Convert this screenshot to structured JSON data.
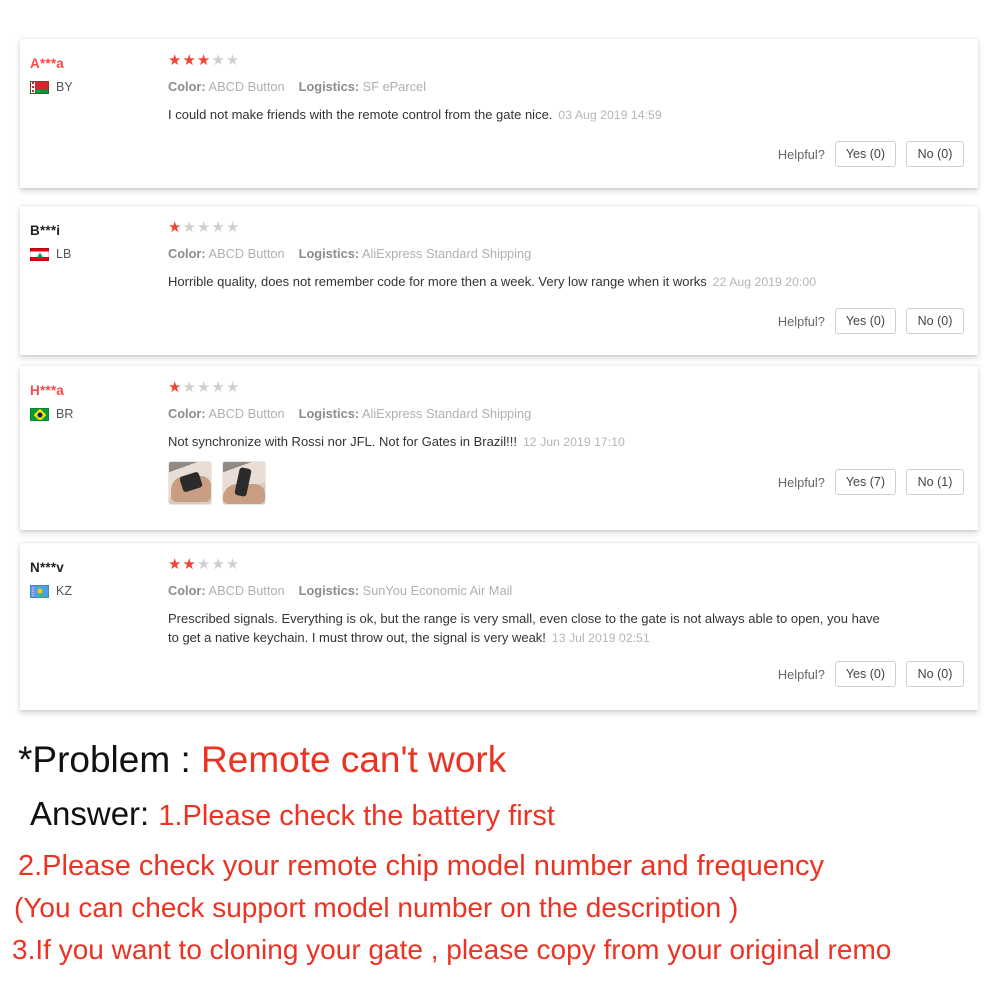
{
  "reviews": [
    {
      "reviewer": "A***a",
      "reviewer_color": "red",
      "country_code": "BY",
      "flag": "flag-belarus",
      "rating": 3,
      "color_key": "Color:",
      "color_value": "ABCD Button",
      "logistics_key": "Logistics:",
      "logistics_value": "SF eParcel",
      "text": "I could not make friends with the remote control from the gate nice.",
      "date": "03 Aug 2019 14:59",
      "helpful_label": "Helpful?",
      "yes_label": "Yes (0)",
      "no_label": "No (0)",
      "images": []
    },
    {
      "reviewer": "B***i",
      "reviewer_color": "dark",
      "country_code": "LB",
      "flag": "flag-lebanon",
      "rating": 1,
      "color_key": "Color:",
      "color_value": "ABCD Button",
      "logistics_key": "Logistics:",
      "logistics_value": "AliExpress Standard Shipping",
      "text": "Horrible quality, does not remember code for more then a week. Very low range when it works",
      "date": "22 Aug 2019 20:00",
      "helpful_label": "Helpful?",
      "yes_label": "Yes (0)",
      "no_label": "No (0)",
      "images": []
    },
    {
      "reviewer": "H***a",
      "reviewer_color": "red",
      "country_code": "BR",
      "flag": "flag-brazil",
      "rating": 1,
      "color_key": "Color:",
      "color_value": "ABCD Button",
      "logistics_key": "Logistics:",
      "logistics_value": "AliExpress Standard Shipping",
      "text": "Not synchronize with Rossi nor JFL. Not for Gates in Brazil!!!",
      "date": "12 Jun 2019 17:10",
      "helpful_label": "Helpful?",
      "yes_label": "Yes (7)",
      "no_label": "No (1)",
      "images": [
        "review-photo-remote-in-hand-1",
        "review-photo-remote-in-hand-2"
      ]
    },
    {
      "reviewer": "N***v",
      "reviewer_color": "dark",
      "country_code": "KZ",
      "flag": "flag-kazakhstan",
      "rating": 2,
      "color_key": "Color:",
      "color_value": "ABCD Button",
      "logistics_key": "Logistics:",
      "logistics_value": "SunYou Economic Air Mail",
      "text": "Prescribed signals. Everything is ok, but the range is very small, even close to the gate is not always able to open, you have to get a native keychain. I must throw out, the signal is very weak!",
      "date": "13 Jul 2019 02:51",
      "helpful_label": "Helpful?",
      "yes_label": "Yes (0)",
      "no_label": "No (0)",
      "images": []
    }
  ],
  "promo": {
    "problem_label": "*Problem : ",
    "problem_value": "Remote can't work",
    "answer_label": "Answer: ",
    "answer_value": "1.Please check the battery first",
    "line2": "2.Please check your remote chip model number and frequency",
    "line3": "(You can check support model number on the description )",
    "line4": "3.If you want to cloning your gate , please copy from your original remo"
  },
  "colors": {
    "star_on": "#f44336",
    "star_off": "#cfcfcf",
    "reviewer_red": "#ff4747",
    "promo_red": "#ec3323",
    "body_text": "#333333",
    "muted": "#b0b0b0"
  }
}
